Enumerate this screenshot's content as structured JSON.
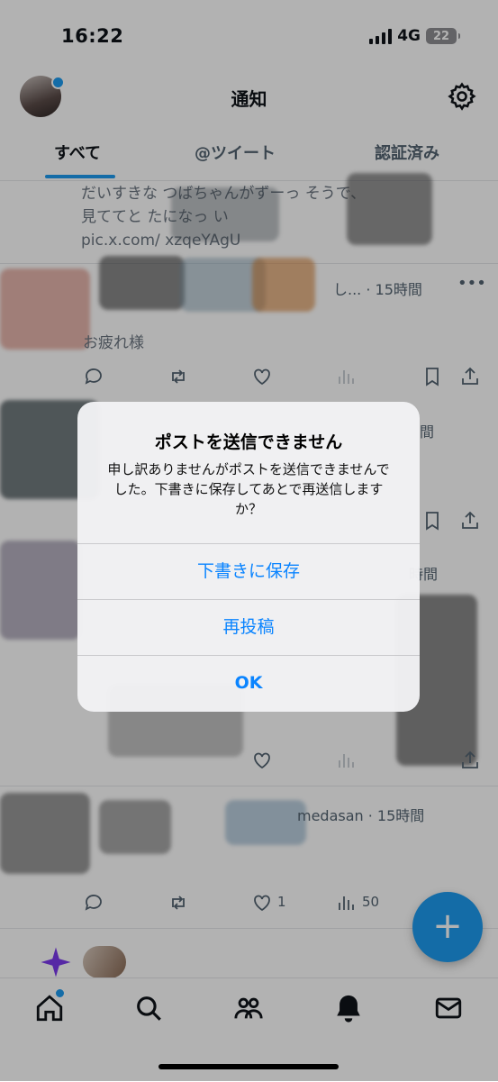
{
  "status_bar": {
    "time": "16:22",
    "network": "4G",
    "battery": "22"
  },
  "header": {
    "title": "通知"
  },
  "tabs": [
    {
      "label": "すべて",
      "active": true
    },
    {
      "label": "@ツイート",
      "active": false
    },
    {
      "label": "認証済み",
      "active": false
    }
  ],
  "feed": {
    "item1": {
      "text_line1": "だいすきな     つばちゃんがずーっ        そうで、",
      "text_line2": "見ててと          たになっ       い",
      "text_line3": "pic.x.com/         xzqeYAgU"
    },
    "item2": {
      "time": "し... · 15時間",
      "snippet": "お疲れ様"
    },
    "item3": {
      "time": "間"
    },
    "item4": {
      "time": "時間"
    },
    "item5": {
      "time": "medasan · 15時間",
      "likes": "1",
      "views": "50"
    }
  },
  "alert": {
    "title": "ポストを送信できません",
    "message": "申し訳ありませんがポストを送信できませんでした。下書きに保存してあとで再送信しますか？",
    "buttons": {
      "save_draft": "下書きに保存",
      "repost": "再投稿",
      "ok": "OK"
    }
  },
  "fab": {
    "label": "+"
  },
  "colors": {
    "accent": "#1d9bf0",
    "alert_button": "#0a84ff",
    "spaces_purple": "#7c3aed"
  },
  "icons": {
    "bottom_nav": [
      "home-icon",
      "search-icon",
      "communities-icon",
      "notifications-icon",
      "messages-icon"
    ],
    "header": [
      "avatar",
      "gear-icon"
    ]
  }
}
